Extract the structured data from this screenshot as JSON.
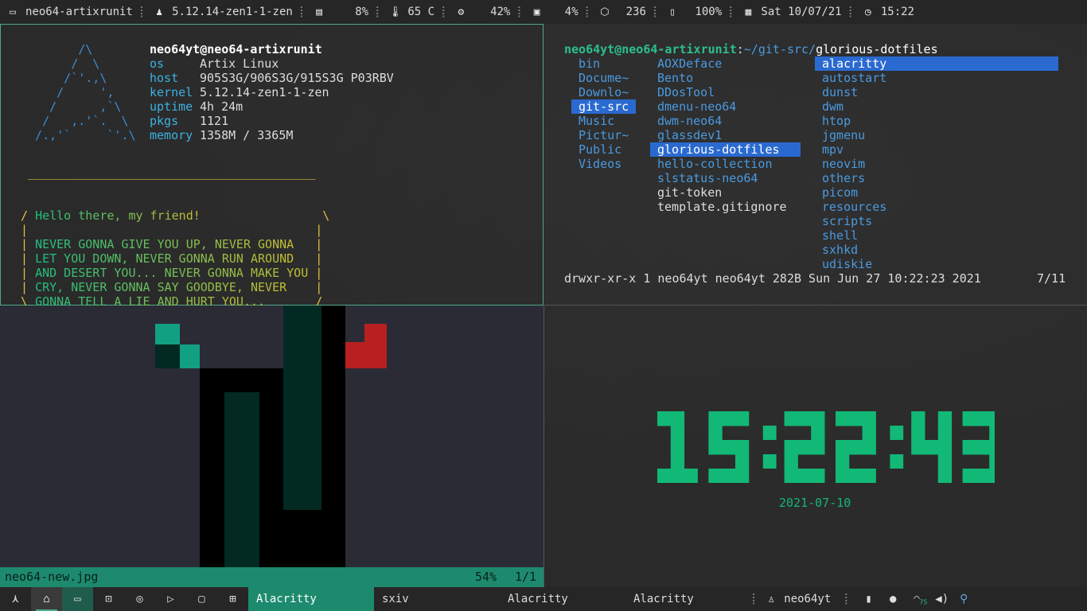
{
  "topbar": {
    "hostname": "neo64-artixrunit",
    "kernel": "5.12.14-zen1-1-zen",
    "cpu": "8%",
    "temp": "65 C",
    "mem": "42%",
    "disk": "4%",
    "pkgs": "236",
    "battery": "100%",
    "date": "Sat 10/07/21",
    "time": "15:22",
    "separator": "⡇",
    "icons": [
      "laptop-icon",
      "linux-icon",
      "cpu-icon",
      "thermometer-icon",
      "memory-icon",
      "disk-icon",
      "package-icon",
      "battery-icon",
      "calendar-icon",
      "clock-icon"
    ]
  },
  "fetch": {
    "logo": [
      "        /\\",
      "       /  \\",
      "      /`'.,\\",
      "     /     ',",
      "    /      ,`\\",
      "   /   ,.'`.  \\",
      "  /.,'`     `'.\\"
    ],
    "user": "neo64yt@neo64-artixrunit",
    "rows": [
      [
        "os",
        "Artix Linux"
      ],
      [
        "host",
        "905S3G/906S3G/915S3G P03RBV"
      ],
      [
        "kernel",
        "5.12.14-zen1-1-zen"
      ],
      [
        "uptime",
        "4h 24m"
      ],
      [
        "pkgs",
        "1121"
      ],
      [
        "memory",
        "1358M / 3365M"
      ]
    ]
  },
  "cowsay": {
    "top": " ________________________________________",
    "bottom": " ----------------------------------------",
    "lines": [
      [
        "/ ",
        "Hello there, my friend!",
        "                 \\"
      ],
      [
        "| ",
        "",
        "                                       |"
      ],
      [
        "| ",
        "NEVER GONNA GIVE YOU UP, NEVER GONNA",
        "   |"
      ],
      [
        "| ",
        "LET YOU DOWN, NEVER GONNA RUN AROUND",
        "   |"
      ],
      [
        "| ",
        "AND DESERT YOU... NEVER GONNA MAKE YOU",
        " |"
      ],
      [
        "| ",
        "CRY, NEVER GONNA SAY GOODBYE, NEVER",
        "    |"
      ],
      [
        "\\ ",
        "GONNA TELL A LIE AND HURT YOU...",
        "       /"
      ]
    ]
  },
  "lf": {
    "prompt_user": "neo64yt@neo64-artixrunit",
    "prompt_sep": ":",
    "prompt_path": "~/git-src/",
    "prompt_dir": "glorious-dotfiles",
    "col1": [
      "bin",
      "Docume~",
      "Downlo~",
      "git-src",
      "Music",
      "Pictur~",
      "Public",
      "Videos"
    ],
    "col2": [
      "AOXDeface",
      "Bento",
      "DDosTool",
      "dmenu-neo64",
      "dwm-neo64",
      "glassdev1",
      "glorious-dotfiles",
      "hello-collection",
      "slstatus-neo64",
      "git-token",
      "template.gitignore"
    ],
    "col3": [
      "alacritty",
      "autostart",
      "dunst",
      "dwm",
      "htop",
      "jgmenu",
      "mpv",
      "neovim",
      "others",
      "picom",
      "resources",
      "scripts",
      "shell",
      "sxhkd",
      "udiskie"
    ],
    "info": "drwxr-xr-x 1 neo64yt neo64yt 282B Sun Jun 27 10:22:23 2021",
    "pos": "7/11"
  },
  "sxiv": {
    "file": "neo64-new.jpg",
    "zoom": "54%",
    "index": "1/1"
  },
  "clock": {
    "time": "15:22:43",
    "date": "2021-07-10",
    "color": "#12b876"
  },
  "dock": {
    "icons": [
      "artix-logo-icon",
      "home-icon",
      "gamepad-icon",
      "terminal-icon",
      "compass-icon",
      "video-icon",
      "briefcase-icon",
      "grid-icon"
    ],
    "tasks": [
      "Alacritty",
      "sxiv",
      "Alacritty",
      "Alacritty"
    ],
    "user": "neo64yt",
    "tray": [
      "battery-charging-icon",
      "mic-icon",
      "wifi-icon",
      "volume-icon",
      "usb-icon"
    ],
    "wifi": "75"
  }
}
